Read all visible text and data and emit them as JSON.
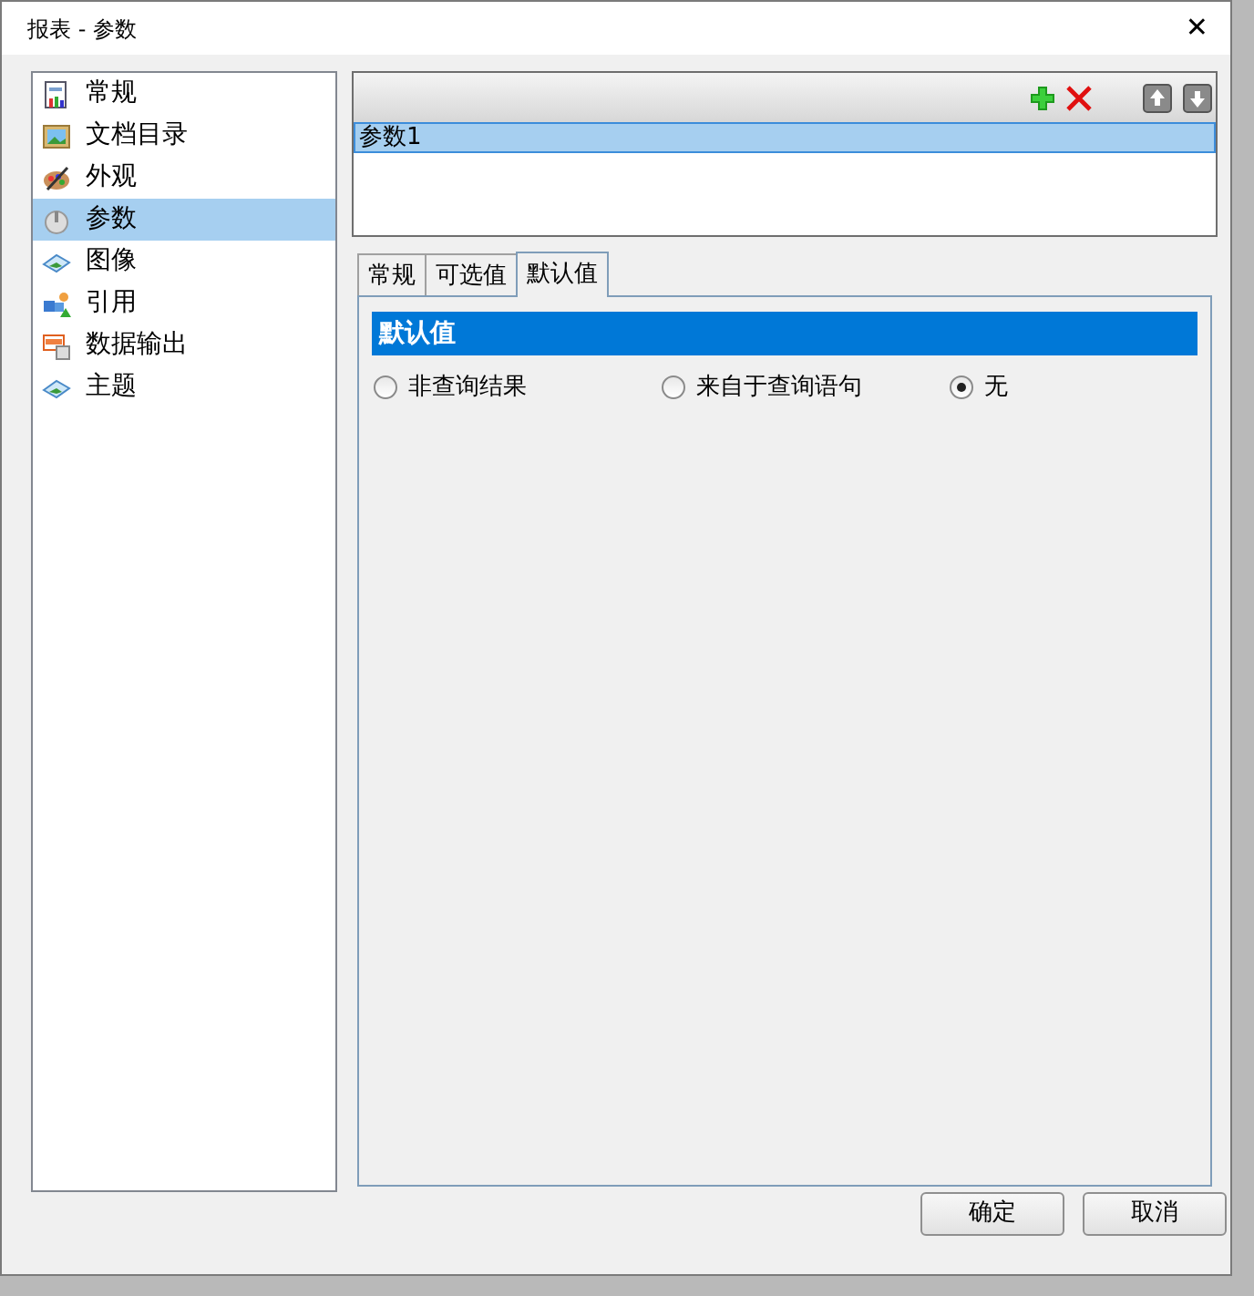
{
  "window": {
    "title": "报表 - 参数",
    "close": "✕"
  },
  "sidebar": {
    "items": [
      {
        "label": "常规",
        "selected": false
      },
      {
        "label": "文档目录",
        "selected": false
      },
      {
        "label": "外观",
        "selected": false
      },
      {
        "label": "参数",
        "selected": true
      },
      {
        "label": "图像",
        "selected": false
      },
      {
        "label": "引用",
        "selected": false
      },
      {
        "label": "数据输出",
        "selected": false
      },
      {
        "label": "主题",
        "selected": false
      }
    ]
  },
  "parameters": {
    "rows": [
      {
        "label": "参数1",
        "selected": true
      }
    ]
  },
  "tabs": [
    {
      "label": "常规",
      "selected": false
    },
    {
      "label": "可选值",
      "selected": false
    },
    {
      "label": "默认值",
      "selected": true
    }
  ],
  "panel": {
    "heading": "默认值",
    "options": [
      {
        "label": "非查询结果",
        "selected": false
      },
      {
        "label": "来自于查询语句",
        "selected": false
      },
      {
        "label": "无",
        "selected": true
      }
    ]
  },
  "buttons": [
    "确定",
    "取消"
  ]
}
